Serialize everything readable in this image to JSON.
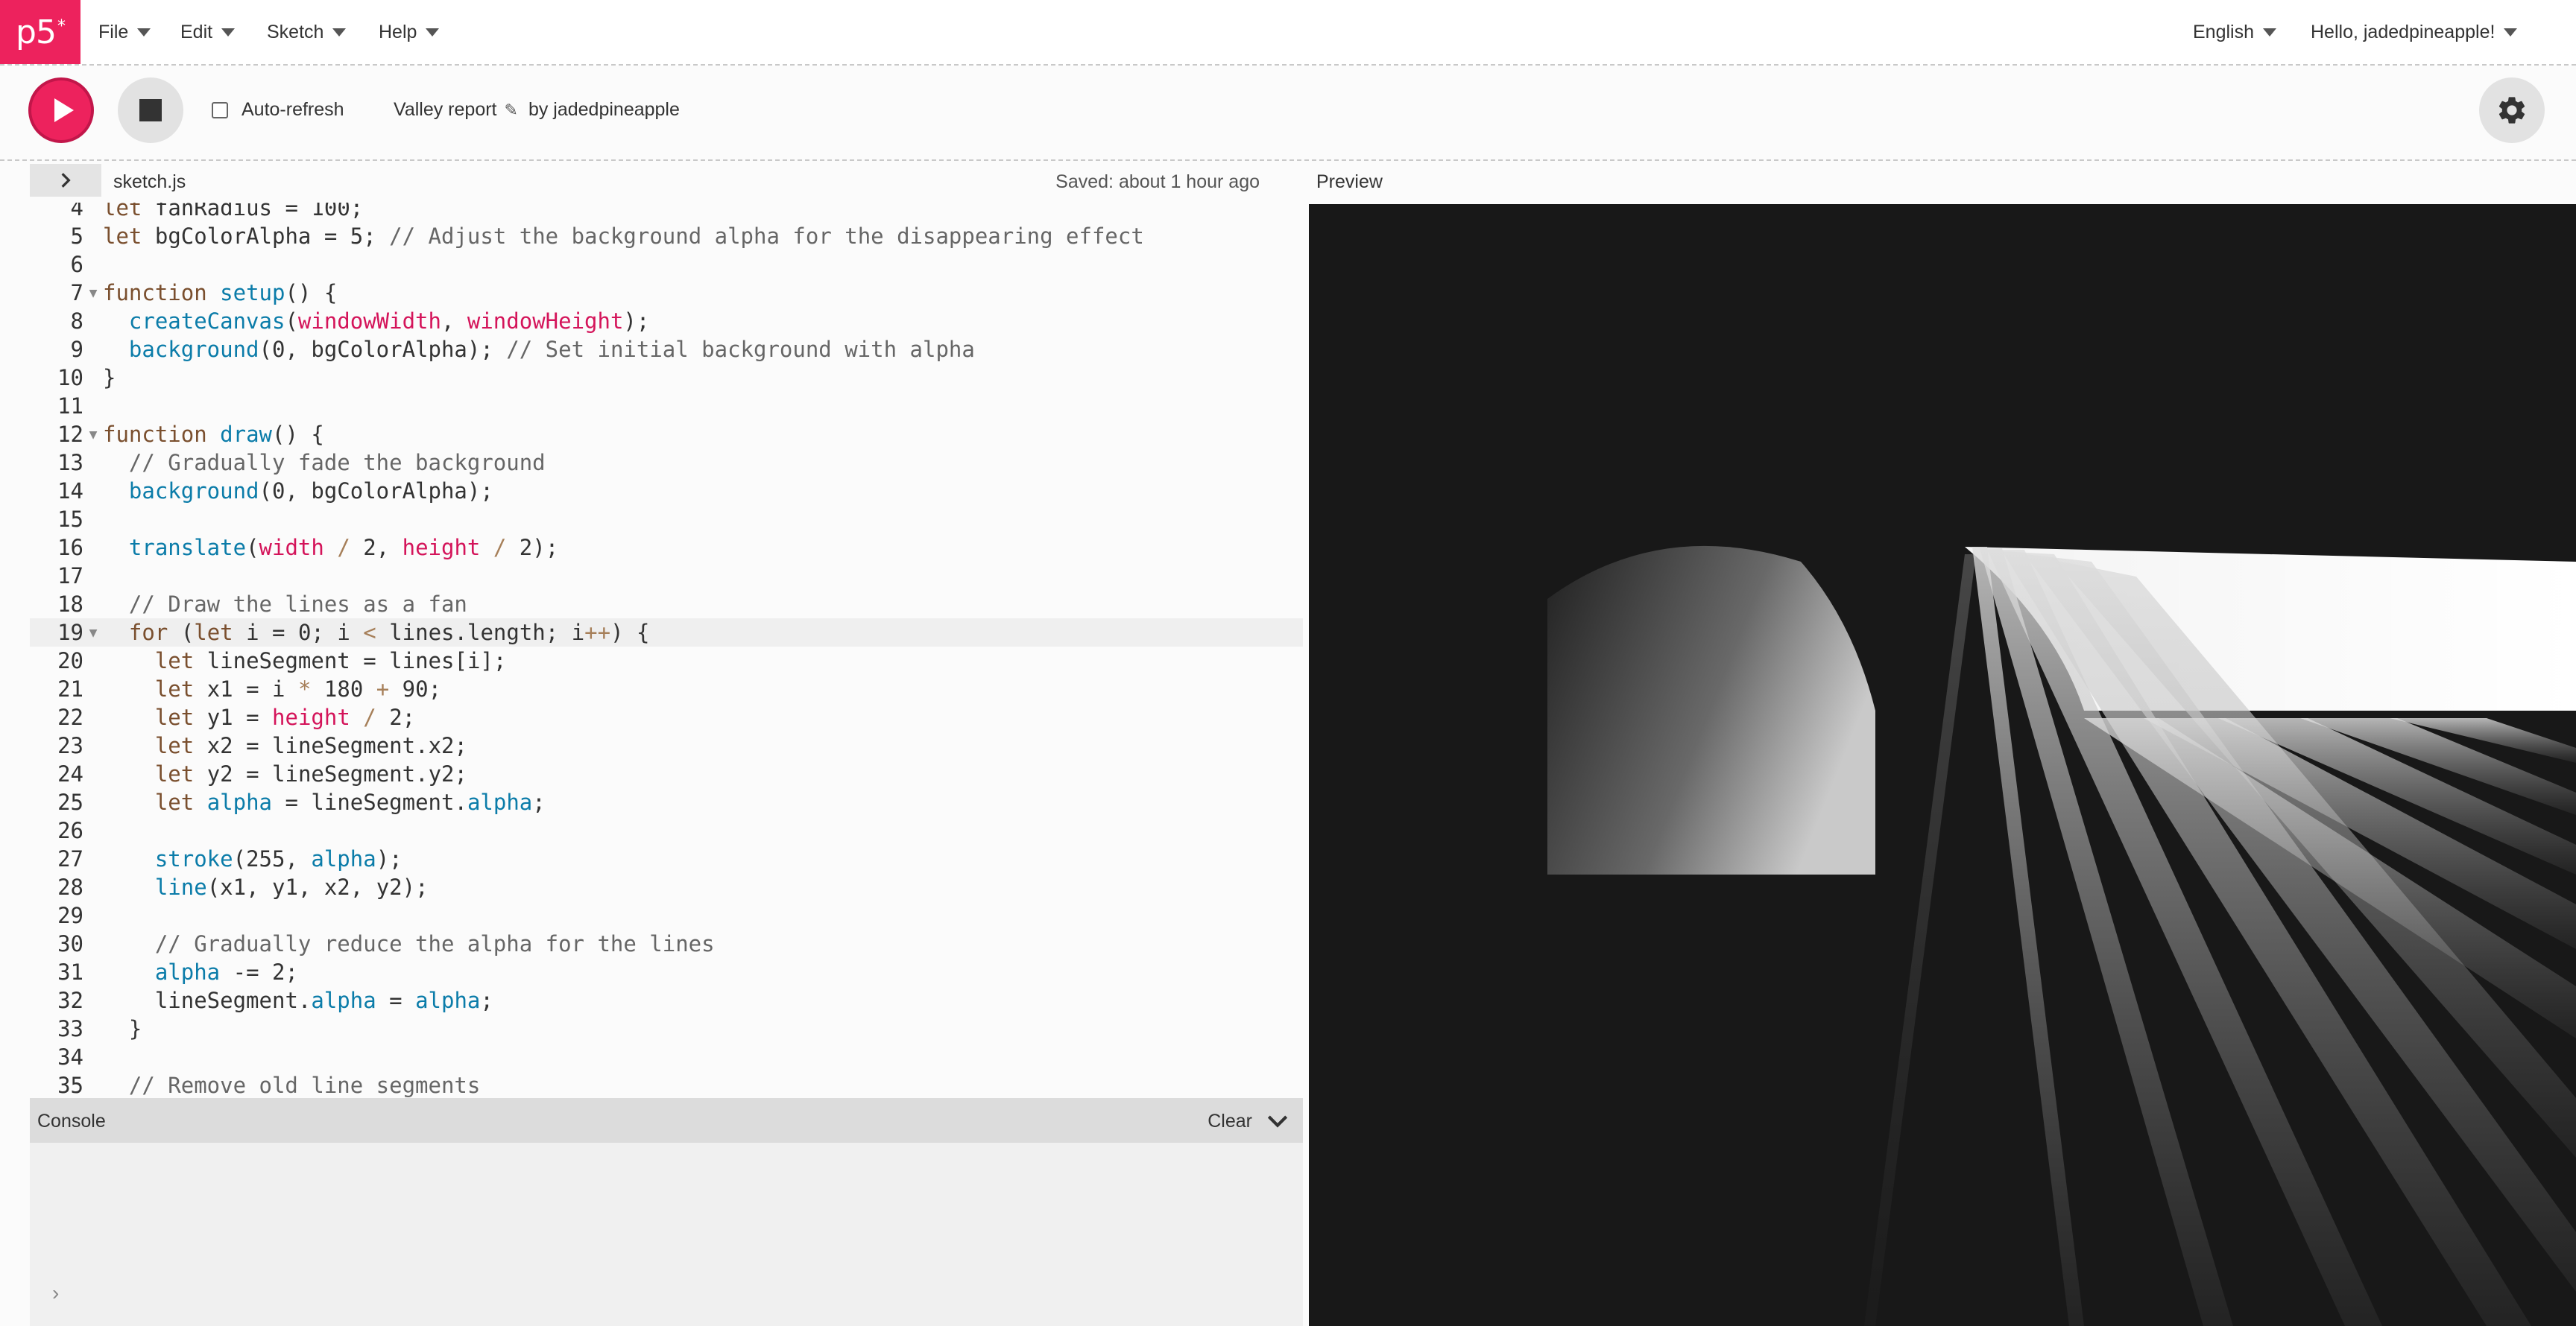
{
  "app": {
    "logo": "p5",
    "logo_mark": "*"
  },
  "nav": {
    "menus": [
      "File",
      "Edit",
      "Sketch",
      "Help"
    ],
    "language": "English",
    "user_greeting": "Hello, jadedpineapple!"
  },
  "toolbar": {
    "auto_refresh_label": "Auto-refresh",
    "auto_refresh_checked": false,
    "project_name": "Valley report",
    "owner": "by jadedpineapple"
  },
  "editor": {
    "file_name": "sketch.js",
    "saved_status": "Saved: about 1 hour ago",
    "first_line_partial": "let fanRadius = 100;",
    "lines": [
      {
        "n": "4",
        "code": "let fanRadius = 100;"
      },
      {
        "n": "5",
        "code": "let bgColorAlpha = 5; // Adjust the background alpha for the disappearing effect"
      },
      {
        "n": "6",
        "code": ""
      },
      {
        "n": "7",
        "code": "function setup() {",
        "fold": true
      },
      {
        "n": "8",
        "code": "  createCanvas(windowWidth, windowHeight);"
      },
      {
        "n": "9",
        "code": "  background(0, bgColorAlpha); // Set initial background with alpha"
      },
      {
        "n": "10",
        "code": "}"
      },
      {
        "n": "11",
        "code": ""
      },
      {
        "n": "12",
        "code": "function draw() {",
        "fold": true
      },
      {
        "n": "13",
        "code": "  // Gradually fade the background"
      },
      {
        "n": "14",
        "code": "  background(0, bgColorAlpha);"
      },
      {
        "n": "15",
        "code": ""
      },
      {
        "n": "16",
        "code": "  translate(width / 2, height / 2);"
      },
      {
        "n": "17",
        "code": ""
      },
      {
        "n": "18",
        "code": "  // Draw the lines as a fan"
      },
      {
        "n": "19",
        "code": "  for (let i = 0; i < lines.length; i++) {",
        "fold": true,
        "active": true
      },
      {
        "n": "20",
        "code": "    let lineSegment = lines[i];"
      },
      {
        "n": "21",
        "code": "    let x1 = i * 180 + 90;"
      },
      {
        "n": "22",
        "code": "    let y1 = height / 2;"
      },
      {
        "n": "23",
        "code": "    let x2 = lineSegment.x2;"
      },
      {
        "n": "24",
        "code": "    let y2 = lineSegment.y2;"
      },
      {
        "n": "25",
        "code": "    let alpha = lineSegment.alpha;"
      },
      {
        "n": "26",
        "code": ""
      },
      {
        "n": "27",
        "code": "    stroke(255, alpha);"
      },
      {
        "n": "28",
        "code": "    line(x1, y1, x2, y2);"
      },
      {
        "n": "29",
        "code": ""
      },
      {
        "n": "30",
        "code": "    // Gradually reduce the alpha for the lines"
      },
      {
        "n": "31",
        "code": "    alpha -= 2;"
      },
      {
        "n": "32",
        "code": "    lineSegment.alpha = alpha;"
      },
      {
        "n": "33",
        "code": "  }"
      },
      {
        "n": "34",
        "code": ""
      },
      {
        "n": "35",
        "code": "  // Remove old line segments"
      }
    ]
  },
  "console": {
    "title": "Console",
    "clear_label": "Clear",
    "prompt": "›"
  },
  "preview": {
    "label": "Preview",
    "background": "#181818"
  },
  "colors": {
    "accent": "#ed225d",
    "keyword": "#7a4f2e",
    "builtin": "#0b7ca9",
    "p5_var": "#d4145a",
    "comment": "#666666"
  },
  "icons": {
    "play": "play-icon",
    "stop": "stop-icon",
    "settings": "gear-icon",
    "expand": "chevron-right-icon",
    "edit": "pencil-icon",
    "collapse_console": "chevron-down-icon"
  }
}
